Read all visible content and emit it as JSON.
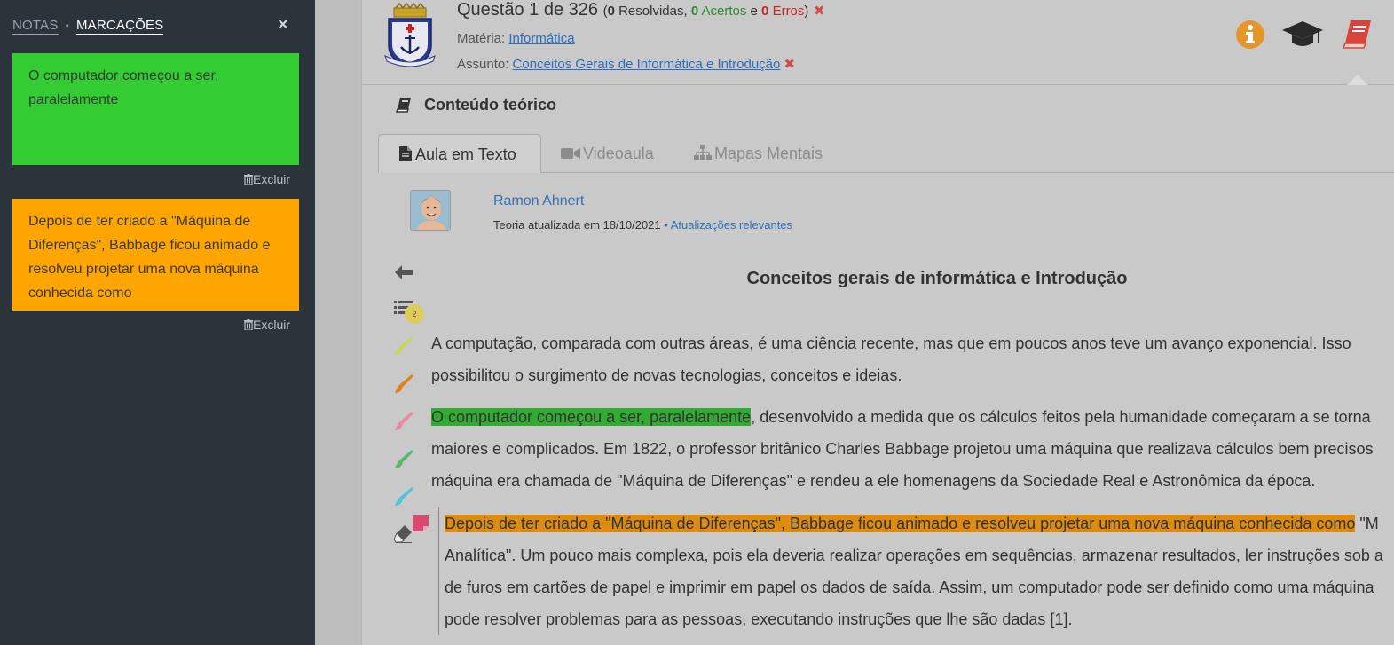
{
  "sidebar": {
    "tab_notas": "NOTAS",
    "tab_sep": "•",
    "tab_marcacoes": "MARCAÇÕES",
    "close_icon": "×",
    "cards": [
      {
        "text": "O computador começou a ser, paralelamente",
        "color": "#33cc33",
        "delete_label": "Excluir"
      },
      {
        "text": "Depois de ter criado a \"Máquina de Diferenças\", Babbage ficou animado e resolveu projetar uma nova máquina conhecida como",
        "color": "#ffa500",
        "delete_label": "Excluir"
      }
    ]
  },
  "header": {
    "question_label": "Questão 1 de 326",
    "open_paren": "(",
    "resolvidas_count": "0",
    "resolvidas_label": "Resolvidas,",
    "acertos_count": "0",
    "acertos_label": "Acertos",
    "e_label": "e",
    "erros_count": "0",
    "erros_label": "Erros",
    "close_paren": ")",
    "materia_label": "Matéria:",
    "materia_value": "Informática",
    "assunto_label": "Assunto:",
    "assunto_value": "Conceitos Gerais de Informática e Introdução",
    "icons": [
      "info-icon",
      "graduation-cap-icon",
      "book-icon"
    ]
  },
  "content": {
    "heading": "Conteúdo teórico",
    "tabs": [
      "Aula em Texto",
      "Videoaula",
      "Mapas Mentais"
    ],
    "author_name": "Ramon Ahnert",
    "updated_text": "Teoria atualizada em 18/10/2021",
    "updated_sep": "•",
    "updated_link": "Atualizações relevantes",
    "toc_badge": "2",
    "article_title": "Conceitos gerais de informática e Introdução",
    "p1_line1": "A computação, comparada com outras áreas, é uma ciência recente, mas que em poucos anos teve um avanço exponencial. Isso",
    "p1_line2": "possibilitou o surgimento de novas tecnologias, conceitos e ideias.",
    "p2_highlight": "O computador começou a ser, paralelamente",
    "p2_line1_rest": ", desenvolvido a medida que os cálculos feitos pela humanidade começaram a se torna",
    "p2_line2": "maiores e complicados.  Em 1822, o professor britânico Charles Babbage projetou uma máquina que realizava cálculos bem precisos",
    "p2_line3": "máquina era chamada de \"Máquina de Diferenças\" e rendeu a ele homenagens da Sociedade Real e Astronômica da época.",
    "p3_highlight": "Depois de ter criado a \"Máquina de Diferenças\", Babbage ficou animado e resolveu projetar uma nova máquina conhecida como",
    "p3_line1_rest": " \"M",
    "p3_line2": "Analítica\". Um pouco mais complexa, pois ela deveria realizar operações em sequências, armazenar resultados, ler instruções sob a",
    "p3_line3": "de furos em cartões de papel e imprimir em papel os dados de saída. Assim, um computador pode ser definido como uma máquina",
    "p3_line4": "pode resolver problemas para as pessoas, executando instruções que lhe são dadas [1]."
  },
  "colors": {
    "highlight_green": "#33aa33",
    "highlight_orange": "#dd8c10",
    "brush_yellow": "#c8d65a",
    "brush_orange": "#e0801a",
    "brush_pink": "#e88aa0",
    "brush_green": "#58b86a",
    "brush_cyan": "#4fc4d6"
  }
}
